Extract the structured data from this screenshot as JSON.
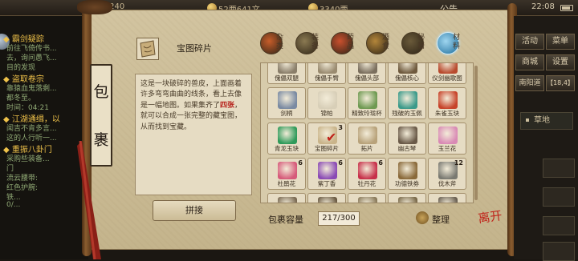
{
  "topbar": {
    "level": "34/240",
    "money_text": "52两641文",
    "gold_text": "3340两",
    "notice_label": "公告",
    "clock": "22:08"
  },
  "quest_panel": {
    "entries": [
      {
        "title": "◆ 霸剑疑踪",
        "lines": [
          "前往飞倚传书...",
          "去，询问愚飞...",
          "目的发现"
        ]
      },
      {
        "title": "◆ 盗取卷宗",
        "lines": [
          "靠猿血鬼落剩...",
          "都冬至。",
          "时间：04:21"
        ]
      },
      {
        "title": "◆ 江湖通缉，以",
        "lines": [
          "闻吉不肯多言...",
          "这的人行听一..."
        ]
      },
      {
        "title": "◆ 重振八卦门",
        "lines": [
          "采购些装备...",
          "门",
          "流云腰带:",
          "红色护腕:",
          "铁...",
          "0/..."
        ]
      }
    ]
  },
  "package_tag": {
    "chars": [
      "包",
      "裹"
    ]
  },
  "detail": {
    "item_name": "宝图碎片",
    "text_before": "这是一块破碎的兽皮，上面画着许多弯弯曲曲的线条，看上去像是一幅地图。如果集齐了",
    "text_highlight": "四张",
    "text_after": "，就可以合成一张完整的藏宝图，从而找到宝藏。",
    "assemble_button": "拼接"
  },
  "categories": [
    {
      "label": "杂类",
      "selected": false,
      "color": "#c75d2a"
    },
    {
      "label": "装备",
      "selected": false,
      "color": "#8b7a52"
    },
    {
      "label": "药品",
      "selected": false,
      "color": "#c9502e"
    },
    {
      "label": "酒食",
      "selected": false,
      "color": "#b4863a"
    },
    {
      "label": "秘籍",
      "selected": false,
      "color": "#6a5a3a"
    },
    {
      "label": "材料",
      "selected": true,
      "color": "#2f8fc4"
    }
  ],
  "items": [
    {
      "name": "傀儡双腿",
      "color": "#8a7e6a",
      "count": "",
      "check": false
    },
    {
      "name": "傀儡手臂",
      "color": "#9a8b70",
      "count": "",
      "check": false
    },
    {
      "name": "傀儡头部",
      "color": "#7b6f5e",
      "count": "",
      "check": false
    },
    {
      "name": "傀儡核心",
      "color": "#6f5a3e",
      "count": "",
      "check": false
    },
    {
      "name": "仪剑幽歌图",
      "color": "#b84a2e",
      "count": "",
      "check": false
    },
    {
      "name": "剑柄",
      "color": "#7a8aa2",
      "count": "",
      "check": false
    },
    {
      "name": "锦帕",
      "color": "#d8cfb8",
      "count": "",
      "check": false
    },
    {
      "name": "精致玲珑杯",
      "color": "#6f9a52",
      "count": "",
      "check": false
    },
    {
      "name": "残破的玉佩",
      "color": "#3b9a8a",
      "count": "",
      "check": false
    },
    {
      "name": "朱雀玉玦",
      "color": "#c7432a",
      "count": "",
      "check": false
    },
    {
      "name": "青龙玉玦",
      "color": "#2f9a5a",
      "count": "",
      "check": false
    },
    {
      "name": "宝图碎片",
      "color": "#c9b48a",
      "count": "3",
      "check": true
    },
    {
      "name": "拓片",
      "color": "#b8a27a",
      "count": "",
      "check": false
    },
    {
      "name": "幽古琴",
      "color": "#6a5a48",
      "count": "",
      "check": false
    },
    {
      "name": "玉兰花",
      "color": "#d98ab5",
      "count": "",
      "check": false
    },
    {
      "name": "杜鹃花",
      "color": "#d65a7a",
      "count": "6",
      "check": false
    },
    {
      "name": "紫丁香",
      "color": "#8a4ab5",
      "count": "6",
      "check": false
    },
    {
      "name": "牡丹花",
      "color": "#c7304a",
      "count": "6",
      "check": false
    },
    {
      "name": "功德铁券",
      "color": "#8a6a3a",
      "count": "",
      "check": false
    },
    {
      "name": "伐木斧",
      "color": "#7a7a72",
      "count": "12",
      "check": false
    },
    {
      "name": "",
      "color": "#7a6a52",
      "count": "",
      "check": false
    },
    {
      "name": "",
      "color": "#6a5a42",
      "count": "",
      "check": false
    },
    {
      "name": "",
      "color": "#8a7a5a",
      "count": "",
      "check": false
    },
    {
      "name": "",
      "color": "#7a6a4a",
      "count": "",
      "check": false
    },
    {
      "name": "",
      "color": "#6a6052",
      "count": "",
      "check": false
    }
  ],
  "footer": {
    "capacity_label": "包裹容量",
    "capacity_value": "217/300",
    "sort_label": "整理",
    "close_seal": "离开"
  },
  "right_panel": {
    "buttons": [
      "活动",
      "菜单",
      "商城",
      "设置",
      "南阳道",
      "【18,4】"
    ],
    "grass": "草地"
  }
}
